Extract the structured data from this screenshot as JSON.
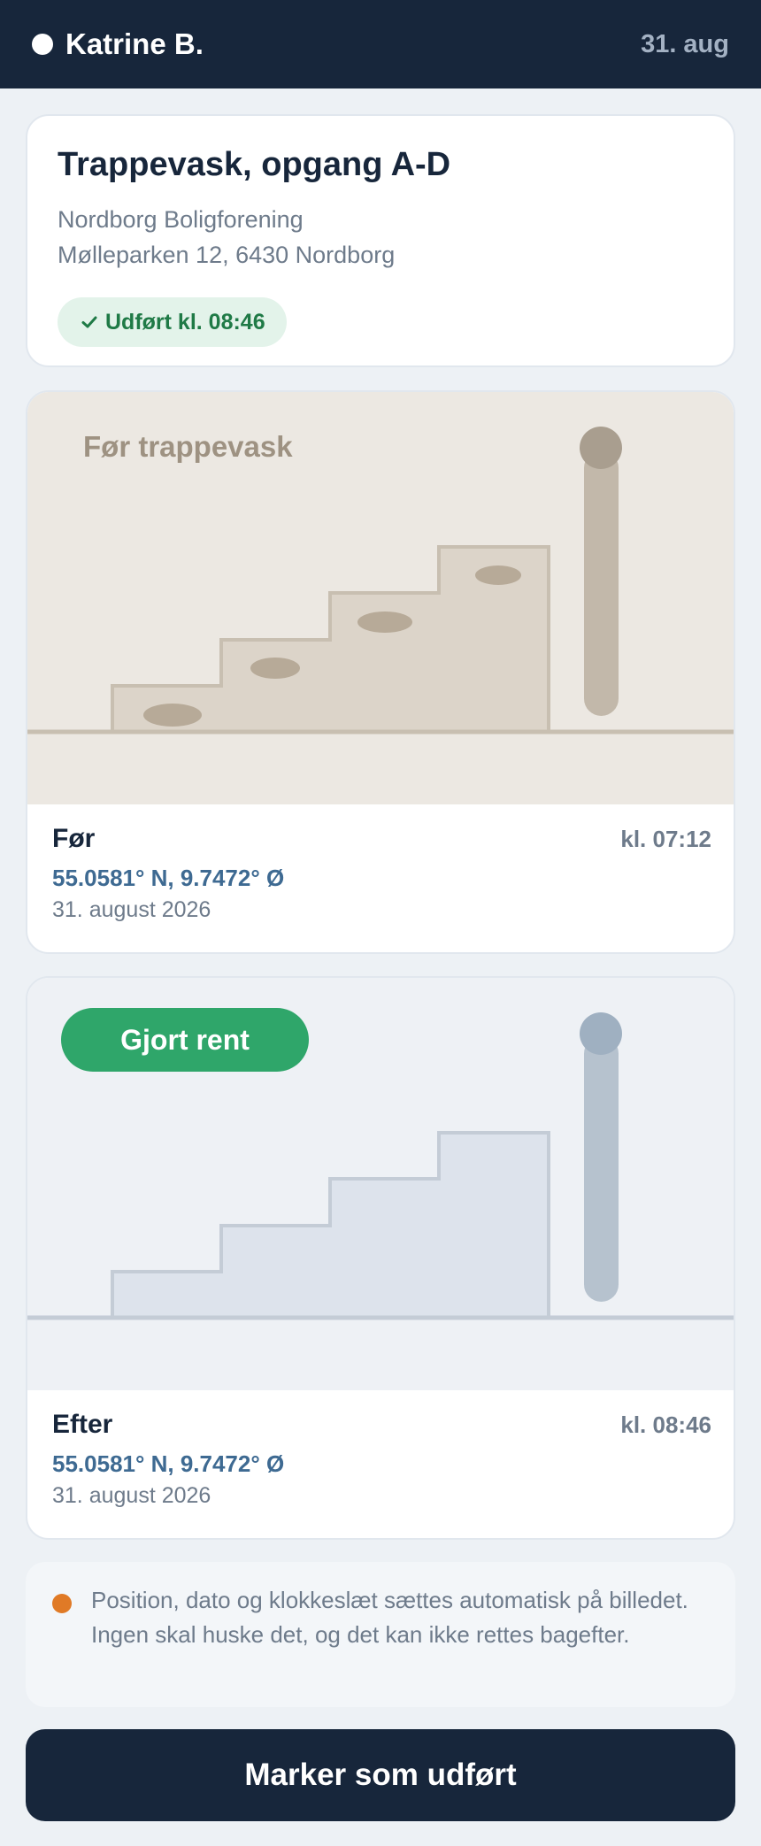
{
  "header": {
    "user_name": "Katrine B.",
    "date": "31. aug"
  },
  "job": {
    "title": "Trappevask, opgang A-D",
    "organization": "Nordborg Boligforening",
    "address": "Mølleparken 12, 6430 Nordborg",
    "status": "Udført kl. 08:46",
    "status_icon": "check-icon"
  },
  "photos": [
    {
      "overlay_text": "Før trappevask",
      "label": "Før",
      "time": "kl. 07:12",
      "coords": "55.0581° N, 9.7472° Ø",
      "date": "31. august 2026"
    },
    {
      "overlay_text": "Gjort rent",
      "label": "Efter",
      "time": "kl. 08:46",
      "coords": "55.0581° N, 9.7472° Ø",
      "date": "31. august 2026"
    }
  ],
  "info": {
    "text": "Position, dato og klokkeslæt sættes automatisk på billedet. Ingen skal huske det, og det kan ikke rettes bagefter."
  },
  "action": {
    "label": "Marker som udført"
  },
  "colors": {
    "header_bg": "#17263b",
    "success": "#2fa66a",
    "success_text": "#1f7a46",
    "coords": "#3e6a92",
    "info_dot": "#e07a26"
  }
}
